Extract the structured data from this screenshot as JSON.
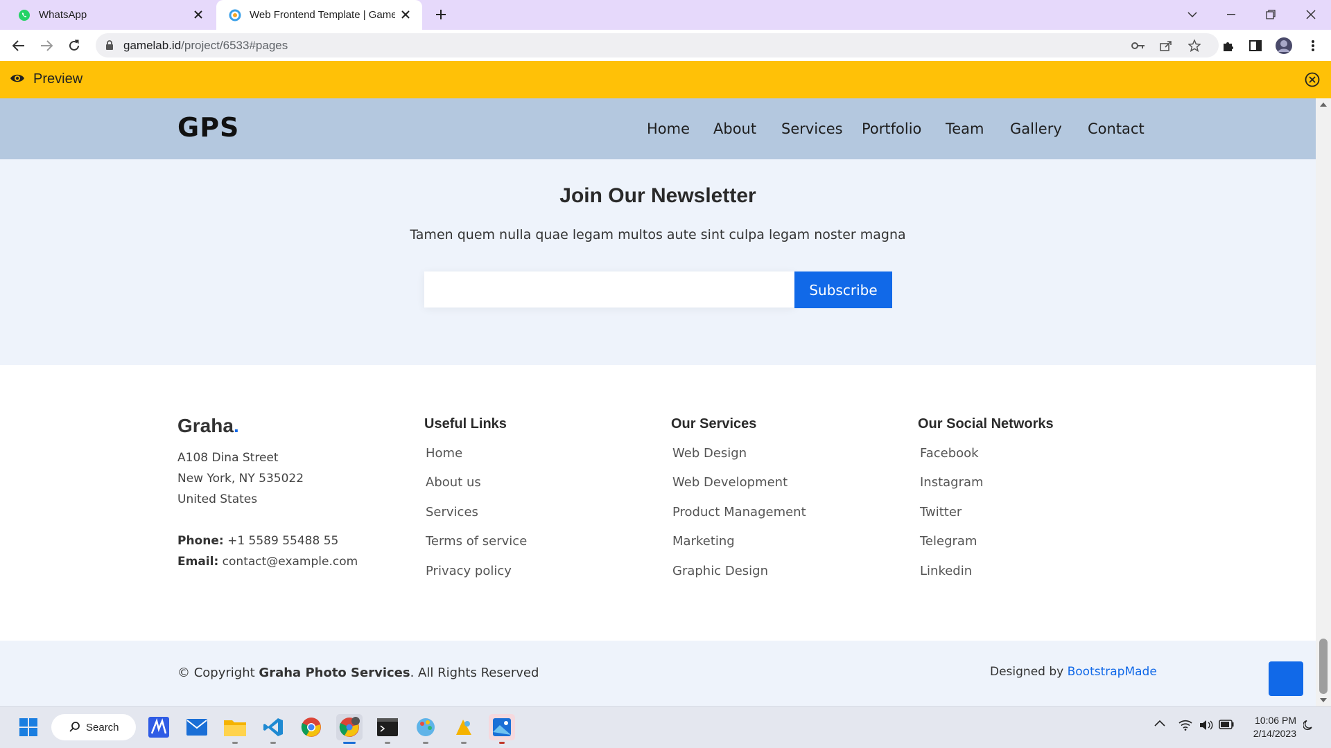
{
  "browser": {
    "tabs": [
      {
        "title": "WhatsApp",
        "icon": "whatsapp-icon"
      },
      {
        "title": "Web Frontend Template | Gamelab",
        "icon": "gamelab-icon",
        "active": true
      }
    ],
    "url_host": "gamelab.id",
    "url_path": "/project/6533#pages"
  },
  "preview_bar": {
    "label": "Preview"
  },
  "site": {
    "logo": "GPS",
    "nav": [
      "Home",
      "About",
      "Services",
      "Portfolio",
      "Team",
      "Gallery",
      "Contact"
    ],
    "newsletter": {
      "title": "Join Our Newsletter",
      "subtitle": "Tamen quem nulla quae legam multos aute sint culpa legam noster magna",
      "input_value": "",
      "button": "Subscribe"
    },
    "footer": {
      "brand": "Graha",
      "brand_dot": ".",
      "address": [
        "A108 Dina Street",
        "New York, NY 535022",
        "United States"
      ],
      "phone_label": "Phone:",
      "phone": "+1 5589 55488 55",
      "email_label": "Email:",
      "email": "contact@example.com",
      "useful_links": {
        "title": "Useful Links",
        "items": [
          "Home",
          "About us",
          "Services",
          "Terms of service",
          "Privacy policy"
        ]
      },
      "services": {
        "title": "Our Services",
        "items": [
          "Web Design",
          "Web Development",
          "Product Management",
          "Marketing",
          "Graphic Design"
        ]
      },
      "social": {
        "title": "Our Social Networks",
        "items": [
          "Facebook",
          "Instagram",
          "Twitter",
          "Telegram",
          "Linkedin"
        ]
      },
      "copyright_prefix": "© Copyright",
      "copyright_name": "Graha Photo Services",
      "copyright_suffix": ". All Rights Reserved",
      "designed_by": "Designed by",
      "designer": "BootstrapMade"
    }
  },
  "taskbar": {
    "search_label": "Search",
    "time": "10:06 PM",
    "date": "2/14/2023"
  },
  "colors": {
    "accent": "#1169e8",
    "preview_bar": "#ffc107",
    "header": "#b4c8df",
    "section_bg": "#eef3fb"
  }
}
